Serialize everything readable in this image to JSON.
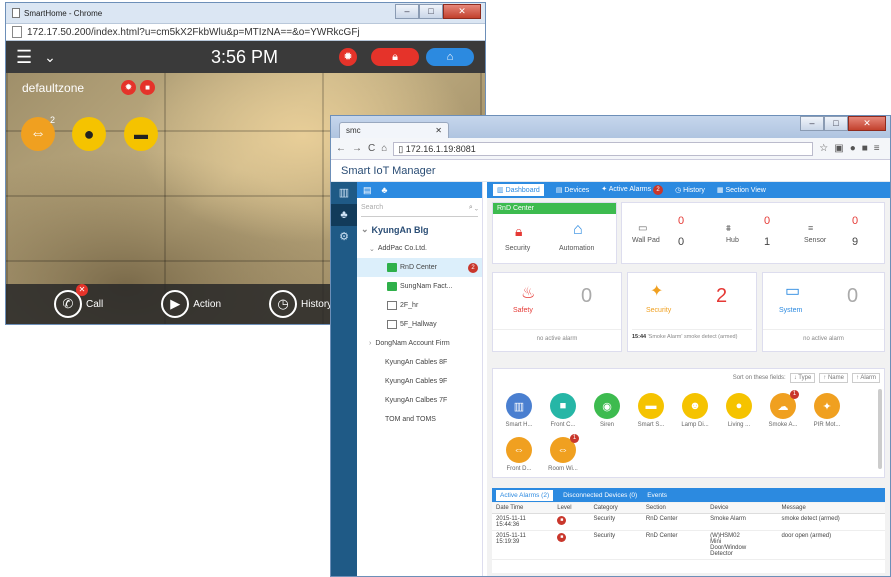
{
  "win1": {
    "title": "SmartHome - Chrome",
    "url": "172.17.50.200/index.html?u=cm5kX2FkbWlu&p=MTIzNA==&o=YWRkcGFj",
    "time": "3:56 PM",
    "zone": "defaultzone",
    "device_badge": "2",
    "bottom": {
      "call": "Call",
      "action": "Action",
      "history": "History"
    }
  },
  "win2": {
    "tab_title": "smc",
    "url": "172.16.1.19:8081",
    "app_title": "Smart IoT Manager",
    "search_placeholder": "Search",
    "tree": {
      "root": "KyungAn Blg",
      "company": "AddPac Co.Ltd.",
      "rnd": "RnD Center",
      "rnd_badge": "2",
      "sungnam": "SungNam Fact...",
      "f2": "2F_hr",
      "f5": "5F_Hallway",
      "dongnam": "DongNam Account Firm",
      "c8": "KyungAn Cables 8F",
      "c9": "KyungAn Cables 9F",
      "c7": "KyungAn Calbes 7F",
      "tom": "TOM and TOMS"
    },
    "tabs": {
      "dashboard": "Dashboard",
      "devices": "Devices",
      "alarms": "Active Alarms",
      "alarms_badge": "2",
      "history": "History",
      "section": "Section View"
    },
    "rnd_card": {
      "title": "RnD Center",
      "security": "Security",
      "automation": "Automation"
    },
    "stats": {
      "wallpad": "Wall Pad",
      "wallpad_a": "0",
      "wallpad_b": "0",
      "hub": "Hub",
      "hub_a": "0",
      "hub_b": "1",
      "sensor": "Sensor",
      "sensor_a": "0",
      "sensor_b": "9"
    },
    "alarms": {
      "safety": "Safety",
      "safety_n": "0",
      "safety_msg": "no active alarm",
      "security": "Security",
      "security_n": "2",
      "security_time": "15:44",
      "security_msg": "'Smoke Alarm' smoke detect (armed)",
      "system": "System",
      "system_n": "0",
      "system_msg": "no active alarm"
    },
    "sort": {
      "label": "Sort on these fields:",
      "type": "Type",
      "name": "Name",
      "alarm": "Alarm"
    },
    "devices": [
      {
        "name": "Smart H...",
        "color": "#4a7fd0",
        "icon": "▥",
        "badge": ""
      },
      {
        "name": "Front C...",
        "color": "#26b6a6",
        "icon": "■",
        "badge": ""
      },
      {
        "name": "Siren",
        "color": "#3dbb4f",
        "icon": "◉",
        "badge": ""
      },
      {
        "name": "Smart S...",
        "color": "#f5c300",
        "icon": "▬",
        "badge": ""
      },
      {
        "name": "Lamp Di...",
        "color": "#f5c300",
        "icon": "☻",
        "badge": ""
      },
      {
        "name": "Living ...",
        "color": "#f5c300",
        "icon": "●",
        "badge": ""
      },
      {
        "name": "Smoke A...",
        "color": "#f0a020",
        "icon": "☁",
        "badge": "1"
      },
      {
        "name": "PIR Mot...",
        "color": "#f0a020",
        "icon": "✦",
        "badge": ""
      },
      {
        "name": "Front D...",
        "color": "#f0a020",
        "icon": "⇔",
        "badge": ""
      },
      {
        "name": "Room Wi...",
        "color": "#f0a020",
        "icon": "⇔",
        "badge": "1"
      }
    ],
    "btabs": {
      "active": "Active Alarms (2)",
      "disconnected": "Disconnected Devices (0)",
      "events": "Events"
    },
    "table": {
      "headers": [
        "Date Time",
        "Level",
        "Category",
        "Section",
        "Device",
        "Message"
      ],
      "rows": [
        [
          "2015-11-11\n15:44:36",
          "",
          "Security",
          "RnD Center",
          "Smoke Alarm",
          "smoke detect (armed)"
        ],
        [
          "2015-11-11\n15:19:39",
          "",
          "Security",
          "RnD Center",
          "(W)HSM02\nMini\nDoor/Window\nDetector",
          "door open (armed)"
        ]
      ]
    }
  }
}
